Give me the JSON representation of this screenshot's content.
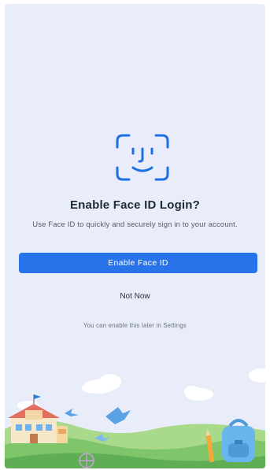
{
  "prompt": {
    "title": "Enable Face ID Login?",
    "subtitle": "Use Face ID to quickly and securely sign in to your account.",
    "primary_button": "Enable Face ID",
    "secondary_button": "Not Now",
    "footnote": "You can enable this later in Settings"
  },
  "icons": {
    "face_id": "face-id-icon"
  },
  "colors": {
    "background": "#e8edf9",
    "accent": "#2873ea",
    "title": "#1f2937"
  }
}
